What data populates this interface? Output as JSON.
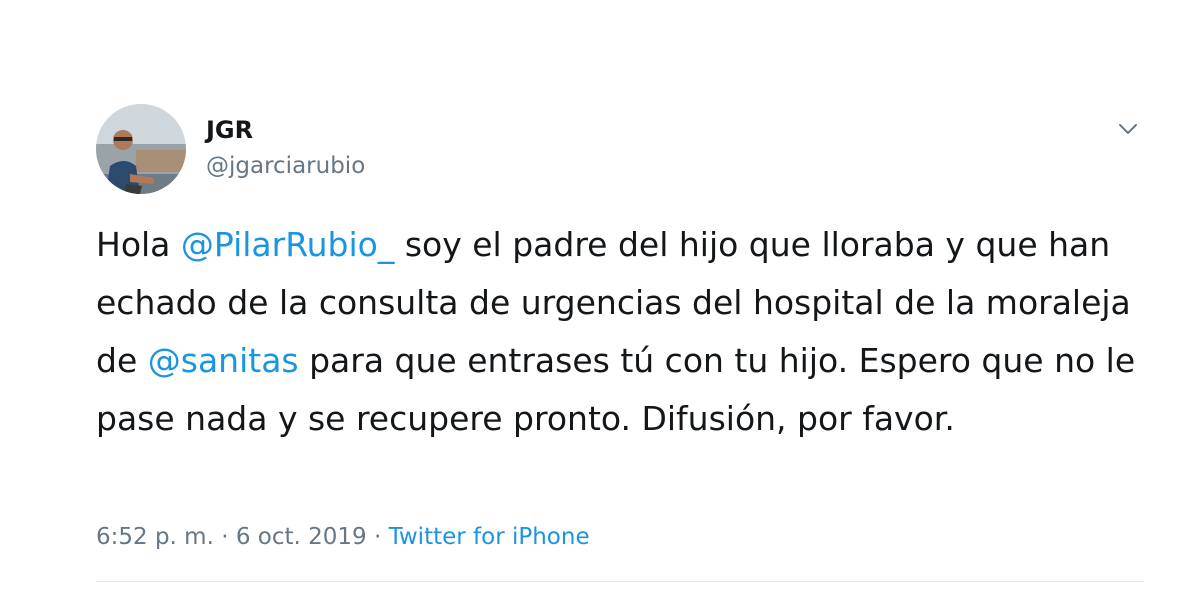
{
  "user": {
    "display_name": "JGR",
    "handle": "@jgarciarubio"
  },
  "icons": {
    "more_menu": "chevron-down-icon",
    "avatar": "avatar-photo"
  },
  "tweet": {
    "segments": {
      "s1": "Hola ",
      "m1": "@PilarRubio_",
      "s2": " soy el padre del hijo que lloraba y que han echado de la consulta de urgencias del hospital de la moraleja de ",
      "m2": "@sanitas",
      "s3": " para que entrases tú con tu hijo. Espero que no le pase nada y se recupere pronto. Difusión, por favor."
    }
  },
  "meta": {
    "time": "6:52 p. m.",
    "sep1": " · ",
    "date": "6 oct. 2019",
    "sep2": " · ",
    "source": "Twitter for iPhone"
  },
  "colors": {
    "link": "#1b95e0",
    "secondary_text": "#657786",
    "primary_text": "#14171a",
    "divider": "#e1e8ed"
  }
}
